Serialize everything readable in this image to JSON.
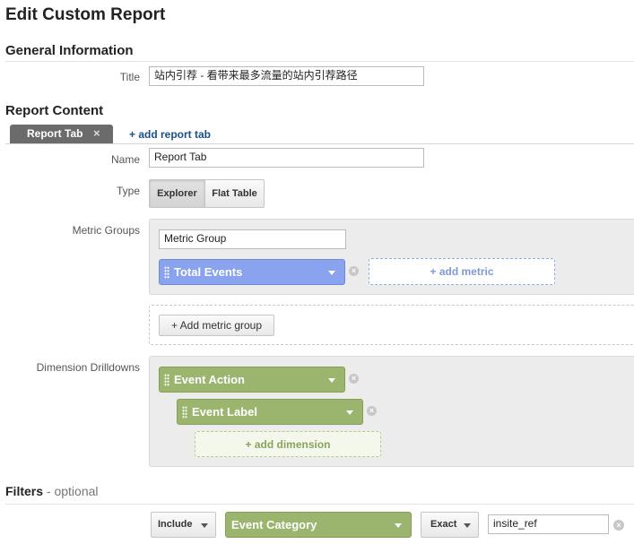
{
  "page_title": "Edit Custom Report",
  "general": {
    "heading": "General Information",
    "title_label": "Title",
    "title_value": "站内引荐 - 看带来最多流量的站内引荐路径"
  },
  "content": {
    "heading": "Report Content",
    "tabs": [
      {
        "label": "Report Tab",
        "close": "×"
      }
    ],
    "add_tab": "+ add report tab",
    "name_label": "Name",
    "name_value": "Report Tab",
    "type_label": "Type",
    "type_options": [
      "Explorer",
      "Flat Table"
    ],
    "type_selected": "Explorer",
    "metric_groups_label": "Metric Groups",
    "metric_group_name": "Metric Group",
    "metrics": [
      {
        "label": "Total Events"
      }
    ],
    "add_metric": "+ add metric",
    "add_metric_group": "+ Add metric group",
    "dimension_label": "Dimension Drilldowns",
    "dimensions": [
      {
        "label": "Event Action"
      },
      {
        "label": "Event Label"
      }
    ],
    "add_dimension": "+ add dimension"
  },
  "filters": {
    "heading": "Filters",
    "heading_suffix": " - optional",
    "include": "Include",
    "dimension": "Event Category",
    "match": "Exact",
    "value": "insite_ref",
    "remove": "×"
  },
  "colors": {
    "metric_blue": "#89a3ef",
    "dimension_green": "#9bb56e",
    "link_blue": "#1a4f8a",
    "tab_gray": "#6b6b6b"
  }
}
